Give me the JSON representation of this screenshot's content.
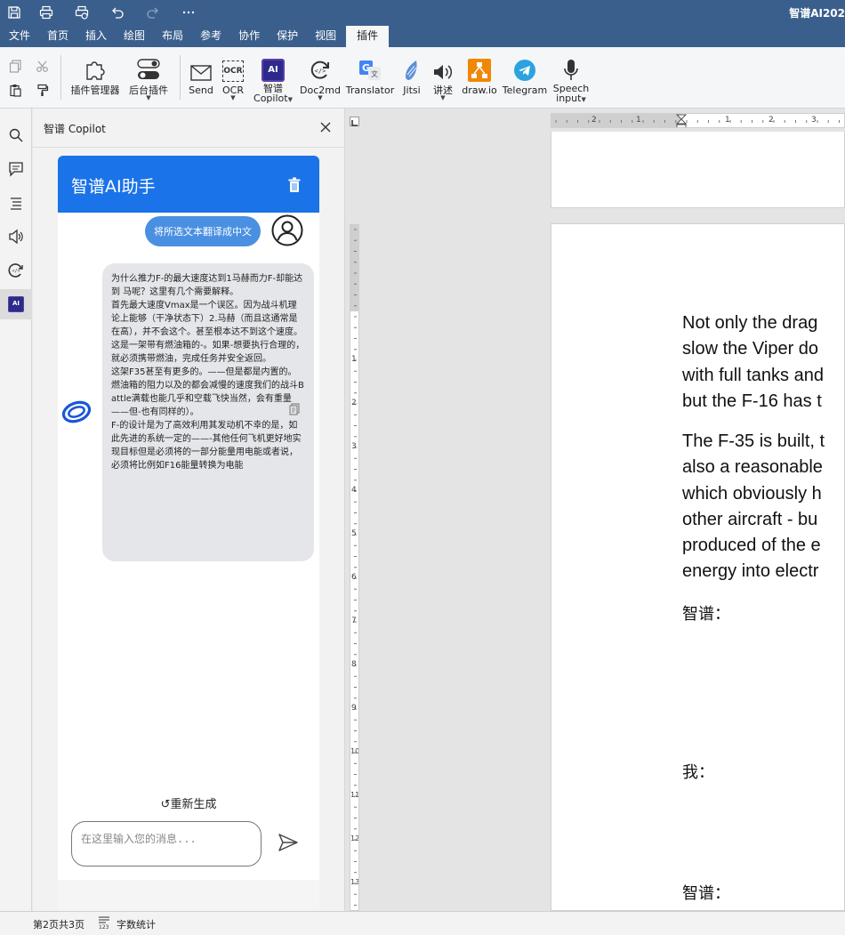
{
  "app": {
    "title": "智谱AI202"
  },
  "menu": {
    "tabs": [
      "文件",
      "首页",
      "插入",
      "绘图",
      "布局",
      "参考",
      "协作",
      "保护",
      "视图",
      "插件"
    ],
    "active_index": 9
  },
  "ribbon": {
    "plugin_manager": "插件管理器",
    "background_plugins": "后台插件",
    "send": "Send",
    "ocr_icon_text": "OCR",
    "ocr": "OCR",
    "ai_icon_text": "AI",
    "zhipu_copilot_line1": "智谱",
    "zhipu_copilot_line2": "Copilot",
    "doc2md": "Doc2md",
    "translator": "Translator",
    "jitsi": "Jitsi",
    "speak": "讲述",
    "drawio": "draw.io",
    "telegram": "Telegram",
    "speech_input_line1": "Speech",
    "speech_input_line2": "input"
  },
  "copilot": {
    "panel_title": "智谱 Copilot",
    "chat_title": "智谱AI助手",
    "user_message": "将所选文本翻译成中文",
    "ai_message": "为什么推力F-的最大速度达到1马赫而力F-却能达到 马呢？这里有几个需要解释。\n首先最大速度Vmax是一个误区。因为战斗机理论上能够（干净状态下）2.马赫（而且这通常是在高），并不会这个。甚至根本达不到这个速度。\n这是一架带有燃油箱的-。如果-想要执行合理的，就必须携带燃油，完成任务并安全返回。\n这架F35甚至有更多的。——但是都是内置的。\n燃油箱的阻力以及的都会减慢的速度我们的战斗Battle满载也能几乎和空载飞快当然，会有重量——但-也有同样的）。\nF-的设计是为了高效利用其发动机不幸的是，如此先进的系统一定的——-其他任何飞机更好地实现目标但是必须将的一部分能量用电能或者说，必须将比例如F16能量转换为电能",
    "regenerate": "↺重新生成",
    "input_placeholder": "在这里输入您的消息..."
  },
  "document": {
    "hruler_numbers": [
      "2",
      "1",
      "1",
      "1",
      "2",
      "3"
    ],
    "vruler_numbers": [
      "1",
      "2",
      "3",
      "4",
      "5",
      "6",
      "7",
      "8",
      "9",
      "10",
      "11",
      "12",
      "13"
    ],
    "para1": [
      "Not only the drag",
      "slow the Viper do",
      "with full tanks and",
      "but the F-16 has t"
    ],
    "para2": [
      "The F-35 is built, t",
      "also a reasonable",
      "which obviously h",
      "other aircraft - bu",
      "produced of the e",
      "energy into electr"
    ],
    "label_zhipu_1": "智谱：",
    "label_me": "我：",
    "label_zhipu_2": "智谱："
  },
  "status": {
    "page_info": "第2页共3页",
    "word_count": "字数统计"
  },
  "colors": {
    "titlebar": "#3b5f8c",
    "accent": "#1a73e8",
    "user_bubble": "#4a90e2",
    "ai_bubble": "#e5e6ea"
  }
}
